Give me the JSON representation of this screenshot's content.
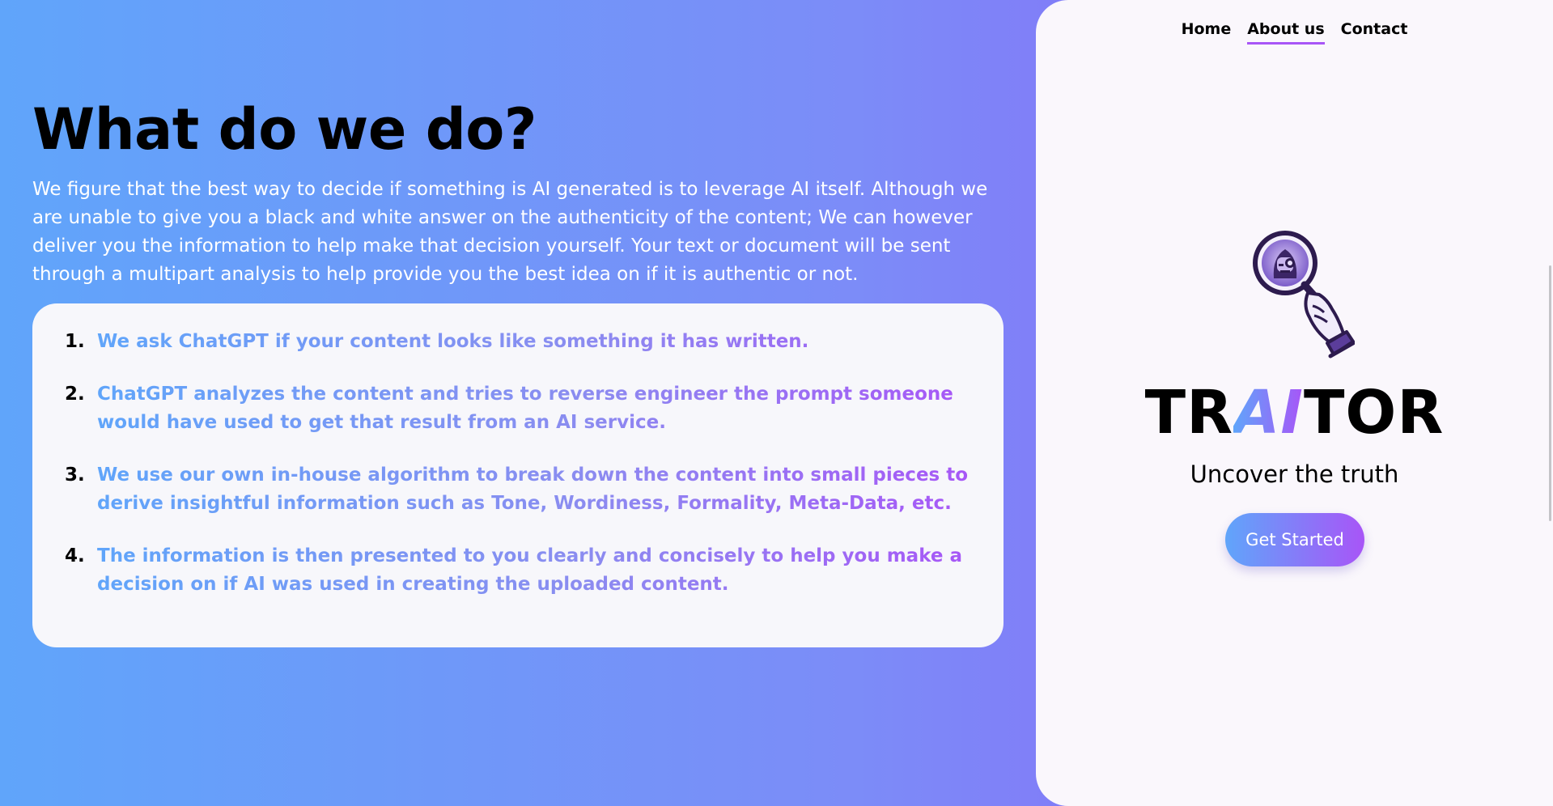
{
  "hero": {
    "title": "What do we do?",
    "intro": "We figure that the best way to decide if something is AI generated is to leverage AI itself. Although we are unable to give you a black and white answer on the authenticity of the content; We can however deliver you the information to help make that decision yourself. Your text or document will be sent through a multipart analysis to help provide you the best idea on if it is authentic or not."
  },
  "steps": [
    {
      "num": "1.",
      "text": "We ask ChatGPT if your content looks like something it has written."
    },
    {
      "num": "2.",
      "text": "ChatGPT analyzes the content and tries to reverse engineer the prompt someone would have used to get that result from an AI service."
    },
    {
      "num": "3.",
      "text": "We use our own in-house algorithm to break down the content into small pieces to derive insightful information such as Tone, Wordiness, Formality, Meta-Data, etc."
    },
    {
      "num": "4.",
      "text": "The information is then presented to you clearly and concisely to help you make a decision on if AI was used in creating the uploaded content."
    }
  ],
  "nav": {
    "items": [
      {
        "label": "Home",
        "active": false
      },
      {
        "label": "About us",
        "active": true
      },
      {
        "label": "Contact",
        "active": false
      }
    ]
  },
  "brand": {
    "prefix": "TR",
    "highlight": "AI",
    "suffix": "TOR",
    "tagline": "Uncover the truth",
    "cta_label": "Get Started",
    "logo_icon": "magnifying-glass-robot-icon"
  },
  "colors": {
    "gradient_start": "#60a5fa",
    "gradient_end": "#8b5cf6",
    "accent_purple": "#a855f7",
    "panel_bg": "#faf7fc"
  }
}
